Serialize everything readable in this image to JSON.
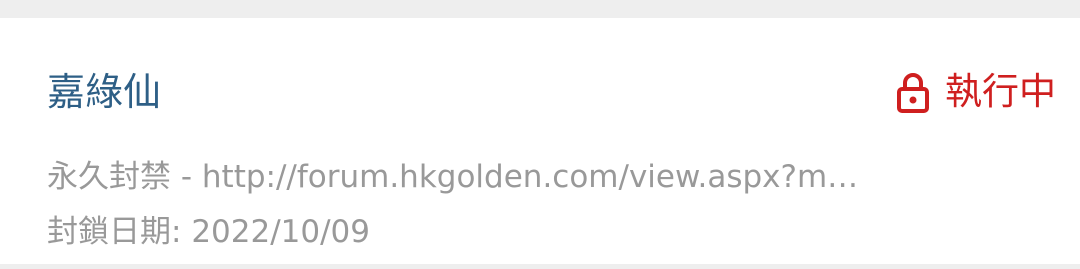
{
  "ban_entry": {
    "username": "嘉綠仙",
    "status": {
      "icon": "lock-icon",
      "text": "執行中",
      "color": "#cf1f1f"
    },
    "reason": "永久封禁 - http://forum.hkgolden.com/view.aspx?m…",
    "date_label": "封鎖日期:",
    "date_value": "2022/10/09"
  }
}
